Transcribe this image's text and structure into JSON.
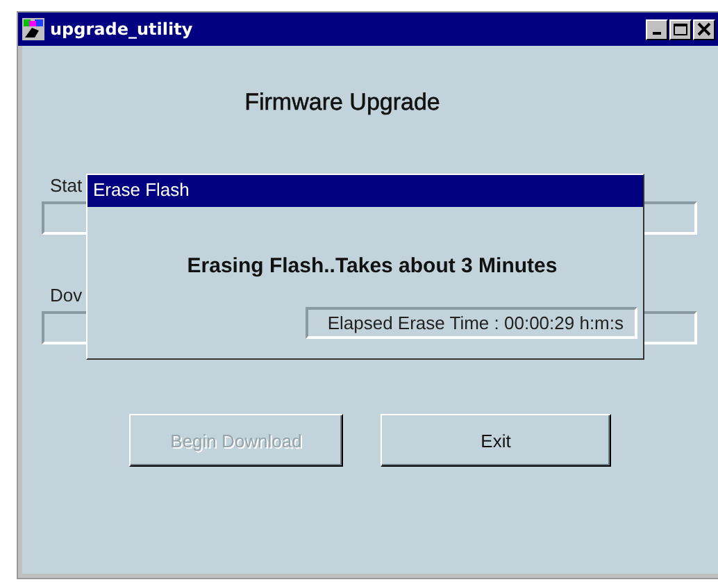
{
  "window": {
    "title": "upgrade_utility"
  },
  "heading": "Firmware Upgrade",
  "fields": [
    {
      "label": "Stat"
    },
    {
      "label": "Dov"
    }
  ],
  "buttons": [
    {
      "label": "Begin Download",
      "disabled": true
    },
    {
      "label": "Exit",
      "disabled": false
    }
  ],
  "dialog": {
    "title": "Erase Flash",
    "message": "Erasing Flash..Takes about 3 Minutes",
    "elapsed": "Elapsed Erase Time : 00:00:29 h:m:s"
  }
}
